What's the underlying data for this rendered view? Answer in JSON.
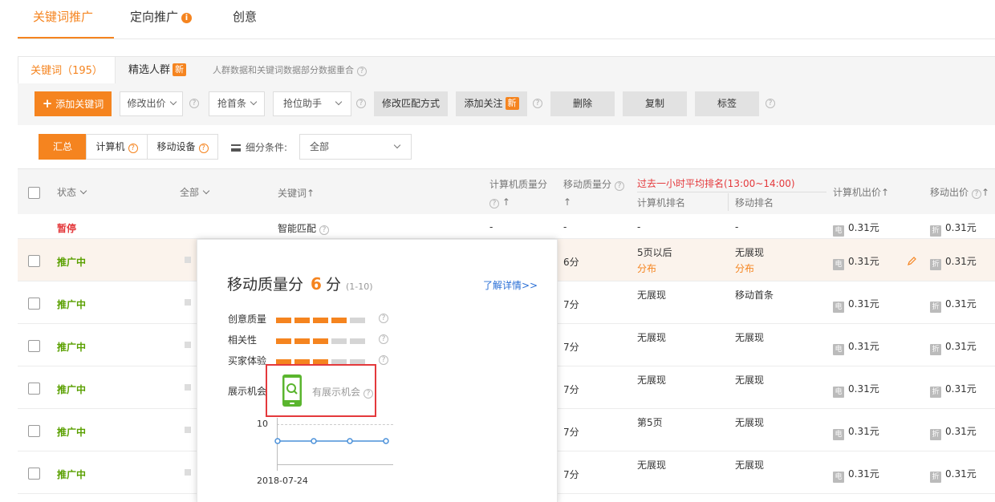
{
  "top_tabs": [
    {
      "label": "关键词推广",
      "active": true
    },
    {
      "label": "定向推广",
      "info": "i"
    },
    {
      "label": "创意"
    }
  ],
  "sub_tabs": {
    "keyword": "关键词（195）",
    "crowd": "精选人群",
    "crowd_badge": "新",
    "hint": "人群数据和关键词数据部分数据重合"
  },
  "toolbar": {
    "add_keyword": "添加关键词",
    "modify_bid": "修改出价",
    "top_bid": "抢首条",
    "rank_helper": "抢位助手",
    "modify_match": "修改匹配方式",
    "add_follow": "添加关注",
    "add_follow_badge": "新",
    "delete": "删除",
    "copy": "复制",
    "tag": "标签"
  },
  "segments": {
    "summary": "汇总",
    "computer": "计算机",
    "mobile": "移动设备",
    "filter_label": "细分条件:",
    "filter_value": "全部"
  },
  "table_header": {
    "status": "状态",
    "all": "全部",
    "keyword": "关键词↑",
    "pc_quality": "计算机质量分",
    "mobile_quality": "移动质量分",
    "rank_period": "过去一小时平均排名(13:00~14:00)",
    "pc_rank": "计算机排名",
    "mobile_rank": "移动排名",
    "pc_bid": "计算机出价↑",
    "mobile_bid": "移动出价"
  },
  "rows": [
    {
      "status": "暂停",
      "paused": true,
      "keyword": "智能匹配",
      "pc_quality": "-",
      "mobile_quality": "-",
      "pc_rank": "-",
      "pc_rank_sub": "",
      "mobile_rank": "-",
      "mobile_rank_sub": "",
      "pc_bid": "0.31元",
      "mobile_bid": "0.31元"
    },
    {
      "status": "推广中",
      "keyword": "",
      "pc_quality": "",
      "mobile_quality": "6分",
      "pc_rank": "5页以后",
      "pc_rank_sub": "分布",
      "mobile_rank": "无展现",
      "mobile_rank_sub": "分布",
      "pc_bid": "0.31元",
      "mobile_bid": "0.31元"
    },
    {
      "status": "推广中",
      "keyword": "",
      "pc_quality": "",
      "mobile_quality": "7分",
      "pc_rank": "无展现",
      "pc_rank_sub": "",
      "mobile_rank": "移动首条",
      "mobile_rank_sub": "",
      "pc_bid": "0.31元",
      "mobile_bid": "0.31元"
    },
    {
      "status": "推广中",
      "keyword": "",
      "pc_quality": "",
      "mobile_quality": "7分",
      "pc_rank": "无展现",
      "pc_rank_sub": "",
      "mobile_rank": "无展现",
      "mobile_rank_sub": "",
      "pc_bid": "0.31元",
      "mobile_bid": "0.31元"
    },
    {
      "status": "推广中",
      "keyword": "",
      "pc_quality": "",
      "mobile_quality": "7分",
      "pc_rank": "无展现",
      "pc_rank_sub": "",
      "mobile_rank": "无展现",
      "mobile_rank_sub": "",
      "pc_bid": "0.31元",
      "mobile_bid": "0.31元"
    },
    {
      "status": "推广中",
      "keyword": "",
      "pc_quality": "",
      "mobile_quality": "7分",
      "pc_rank": "第5页",
      "pc_rank_sub": "",
      "mobile_rank": "无展现",
      "mobile_rank_sub": "",
      "pc_bid": "0.31元",
      "mobile_bid": "0.31元"
    },
    {
      "status": "推广中",
      "keyword": "",
      "pc_quality": "",
      "mobile_quality": "7分",
      "pc_rank": "无展现",
      "pc_rank_sub": "",
      "mobile_rank": "无展现",
      "mobile_rank_sub": "",
      "pc_bid": "0.31元",
      "mobile_bid": "0.31元"
    }
  ],
  "price_tag_pc": "电",
  "price_tag_mobile": "折",
  "popover": {
    "title": "移动质量分",
    "score": "6",
    "unit": "分",
    "range": "(1-10)",
    "link": "了解详情>>",
    "metrics": [
      {
        "label": "创意质量",
        "level": 4
      },
      {
        "label": "相关性",
        "level": 3
      },
      {
        "label": "买家体验",
        "level": 3
      }
    ],
    "metric_max": 5,
    "opportunity_label": "展示机会",
    "opportunity_text": "有展示机会",
    "chart_y_tick": "10",
    "chart_x_label": "2018-07-24"
  },
  "colors": {
    "accent": "#f5841f",
    "active_status": "#5aa000",
    "paused_status": "#e4393c",
    "link": "#2a6fd6",
    "mobile_icon": "#5ab52e"
  }
}
